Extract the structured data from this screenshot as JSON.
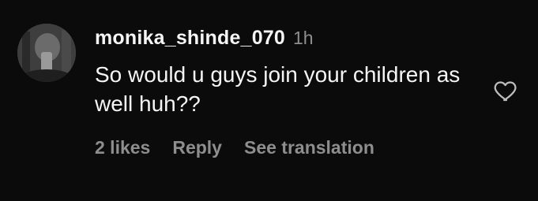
{
  "comment": {
    "username": "monika_shinde_070",
    "time": "1h",
    "text": "So would u guys join your children as well huh??",
    "actions": {
      "likes": "2 likes",
      "reply": "Reply",
      "translate": "See translation"
    },
    "like_icon": "heart-outline-icon",
    "avatar_icon": "user-avatar"
  },
  "colors": {
    "background": "#0b0b0b",
    "primary_text": "#f5f5f5",
    "secondary_text": "#8e8e8e"
  }
}
